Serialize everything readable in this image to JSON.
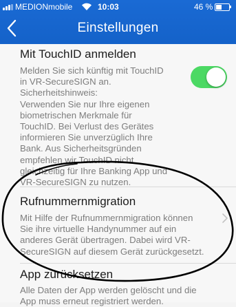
{
  "status_bar": {
    "carrier": "MEDIONmobile",
    "time": "10:03",
    "battery": "46 %"
  },
  "nav": {
    "back_icon": "chevron-left-icon",
    "title": "Einstellungen"
  },
  "touchid": {
    "title": "Mit TouchID anmelden",
    "description": "Melden Sie sich künftig mit TouchID\nin VR-SecureSIGN an.\nSicherheitshinweis:\nVerwenden Sie nur Ihre eigenen\nbiometrischen Merkmale für\nTouchID. Bei Verlust des Gerätes\ninformieren Sie unverzüglich Ihre\nBank. Aus Sicherheitsgründen\nempfehlen wir TouchID nicht\ngleichzeitig für Ihre Banking App und\nVR-SecureSIGN zu nutzen.",
    "toggle_on": true,
    "toggle_color": "#4cd964"
  },
  "migration": {
    "title": "Rufnummernmigration",
    "description": "Mit Hilfe der Rufnummernmigration können\nSie ihre virtuelle Handynummer auf ein\nanderes Gerät übertragen. Dabei wird VR-\nSecureSIGN auf diesem Gerät zurückgesetzt."
  },
  "reset": {
    "title": "App zurücksetzen",
    "description": "Alle Daten der App werden gelöscht und die\nApp muss erneut registriert werden."
  },
  "colors": {
    "header_blue": "#1565cc",
    "background": "#f7f7f7"
  }
}
